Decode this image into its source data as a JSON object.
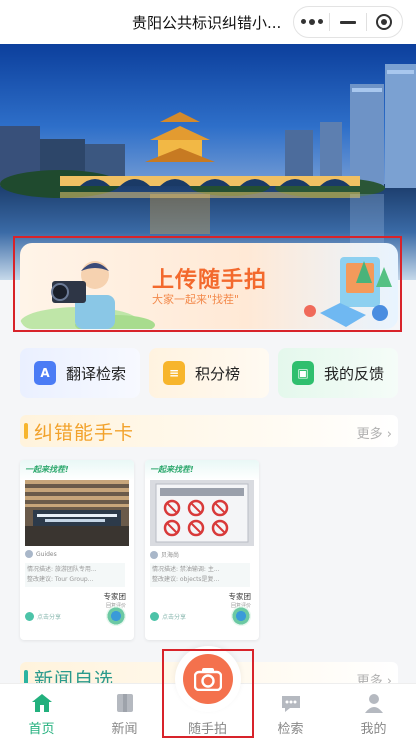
{
  "titlebar": {
    "title": "贵阳公共标识纠错小..."
  },
  "upload_banner": {
    "title": "上传随手拍",
    "subtitle": "大家一起来\"找茬\""
  },
  "quick_actions": [
    {
      "label": "翻译检索",
      "icon": "translate-icon",
      "color": "#4b7cf5"
    },
    {
      "label": "积分榜",
      "icon": "points-icon",
      "color": "#f7b52c"
    },
    {
      "label": "我的反馈",
      "icon": "feedback-icon",
      "color": "#2fbf6e"
    }
  ],
  "section_correction": {
    "title": "纠错能手卡",
    "more": "更多 ›"
  },
  "cards": [
    {
      "tag": "一起来找茬!",
      "user": "Guides",
      "desc1": "情况描述: 旅游团队专用...",
      "desc2": "整改建议: Tour Group...",
      "expert": "专家团",
      "expert_sub": "回复评价",
      "footer": "点击分享"
    },
    {
      "tag": "一起来找茬!",
      "user": "贝海尚",
      "desc1": "情况描述: 禁油输调: 主...",
      "desc2": "整改建议: objects是复...",
      "expert": "专家团",
      "expert_sub": "回复评价",
      "footer": "点击分享"
    }
  ],
  "section_news": {
    "title": "新闻自选",
    "more": "更多 ›"
  },
  "tabbar": [
    {
      "label": "首页",
      "icon": "home-icon",
      "active": true
    },
    {
      "label": "新闻",
      "icon": "news-icon",
      "active": false
    },
    {
      "label": "随手拍",
      "icon": "camera-icon",
      "active": false
    },
    {
      "label": "检索",
      "icon": "search-chat-icon",
      "active": false
    },
    {
      "label": "我的",
      "icon": "profile-icon",
      "active": false
    }
  ],
  "colors": {
    "accent": "#22b07d",
    "orange": "#f3692d",
    "highlight": "#d8232a"
  }
}
